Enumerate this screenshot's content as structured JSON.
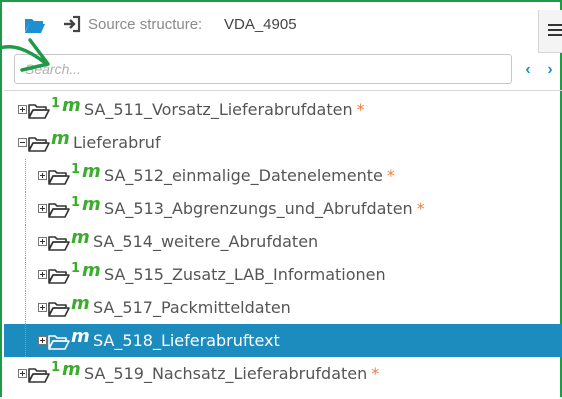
{
  "header": {
    "source_label": "Source structure:",
    "source_value": "VDA_4905"
  },
  "search": {
    "placeholder": "Search..."
  },
  "nav": {
    "prev": "‹",
    "next": "›"
  },
  "colors": {
    "frame_border": "#1f9a48",
    "cardinality_badge": "#3aad2c",
    "selection": "#1b8cbd",
    "required_marker": "#f07e3a",
    "nav_accent": "#1e8fd0"
  },
  "tree": [
    {
      "level": 0,
      "toggle": "plus",
      "cardinality": "1",
      "badge_m": "m",
      "label": "SA_511_Vorsatz_Lieferabrufdaten",
      "required": "*",
      "selected": false
    },
    {
      "level": 0,
      "toggle": "minus",
      "cardinality": "",
      "badge_m": "m",
      "label": "Lieferabruf",
      "required": "",
      "selected": false
    },
    {
      "level": 1,
      "toggle": "plus",
      "cardinality": "1",
      "badge_m": "m",
      "label": "SA_512_einmalige_Datenelemente",
      "required": "*",
      "selected": false
    },
    {
      "level": 1,
      "toggle": "plus",
      "cardinality": "1",
      "badge_m": "m",
      "label": "SA_513_Abgrenzungs_und_Abrufdaten",
      "required": "*",
      "selected": false
    },
    {
      "level": 1,
      "toggle": "plus",
      "cardinality": "",
      "badge_m": "m",
      "label": "SA_514_weitere_Abrufdaten",
      "required": "",
      "selected": false
    },
    {
      "level": 1,
      "toggle": "plus",
      "cardinality": "1",
      "badge_m": "m",
      "label": "SA_515_Zusatz_LAB_Informationen",
      "required": "",
      "selected": false
    },
    {
      "level": 1,
      "toggle": "plus",
      "cardinality": "",
      "badge_m": "m",
      "label": "SA_517_Packmitteldaten",
      "required": "",
      "selected": false
    },
    {
      "level": 1,
      "toggle": "plus",
      "cardinality": "",
      "badge_m": "m",
      "label": "SA_518_Lieferabruftext",
      "required": "",
      "selected": true
    },
    {
      "level": 0,
      "toggle": "plus",
      "cardinality": "1",
      "badge_m": "m",
      "label": "SA_519_Nachsatz_Lieferabrufdaten",
      "required": "*",
      "selected": false
    }
  ]
}
